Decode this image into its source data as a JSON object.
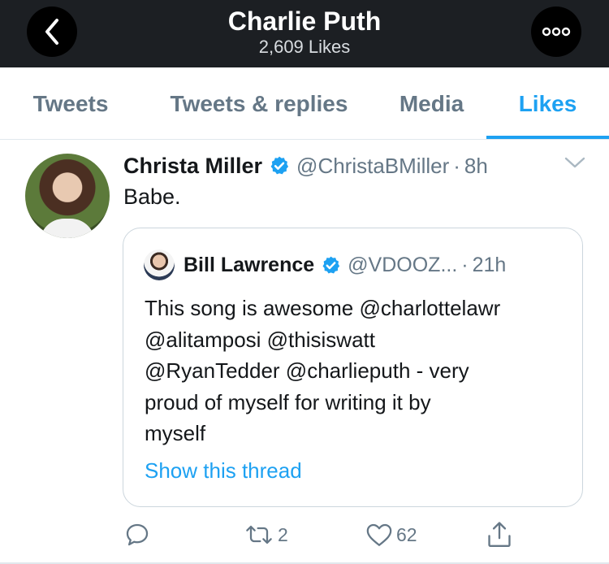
{
  "header": {
    "title": "Charlie Puth",
    "subtitle": "2,609 Likes",
    "back_icon": "chevron-left-icon",
    "more_icon": "more-icon"
  },
  "tabs": [
    {
      "label": "Tweets",
      "active": false
    },
    {
      "label": "Tweets & replies",
      "active": false
    },
    {
      "label": "Media",
      "active": false
    },
    {
      "label": "Likes",
      "active": true
    }
  ],
  "tweet": {
    "author_name": "Christa Miller",
    "verified": true,
    "handle": "@ChristaBMiller",
    "separator": "·",
    "time": "8h",
    "text": "Babe.",
    "quote": {
      "author_name": "Bill Lawrence",
      "verified": true,
      "handle": "@VDOOZ...",
      "separator": "·",
      "time": "21h",
      "text_lines": [
        "This song is awesome @charlottelawr",
        "@alitamposi @thisiswatt",
        "@RyanTedder @charlieputh - very",
        "proud of myself for writing it by",
        "myself"
      ],
      "show_thread_label": "Show this thread"
    },
    "actions": {
      "reply_icon": "reply-icon",
      "retweet_icon": "retweet-icon",
      "retweet_count": "2",
      "like_icon": "heart-icon",
      "like_count": "62",
      "share_icon": "share-icon"
    }
  },
  "colors": {
    "accent": "#1da1f2",
    "header_bg": "#1c1f23",
    "muted_text": "#657786",
    "verified": "#1da1f2"
  }
}
